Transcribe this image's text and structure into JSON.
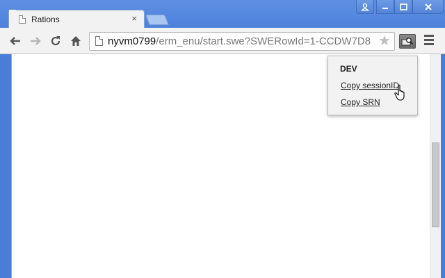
{
  "tab": {
    "title": "Rations",
    "close_glyph": "×"
  },
  "window_controls": {
    "user_icon": "user-icon",
    "minimize_icon": "minimize-icon",
    "maximize_icon": "maximize-icon",
    "close_icon": "close-icon"
  },
  "toolbar": {
    "back_icon": "back-arrow-icon",
    "forward_icon": "forward-arrow-icon",
    "reload_icon": "reload-icon",
    "home_icon": "home-icon",
    "url_host": "nyvm0799",
    "url_path": "/erm_enu/start.swe?SWERowId=1-CCDW7D8",
    "star_icon": "bookmark-star-icon",
    "extension_icon": "extension-icon",
    "menu_icon": "menu-icon"
  },
  "popup": {
    "title": "DEV",
    "links": [
      "Copy sessionID",
      "Copy SRN"
    ]
  }
}
